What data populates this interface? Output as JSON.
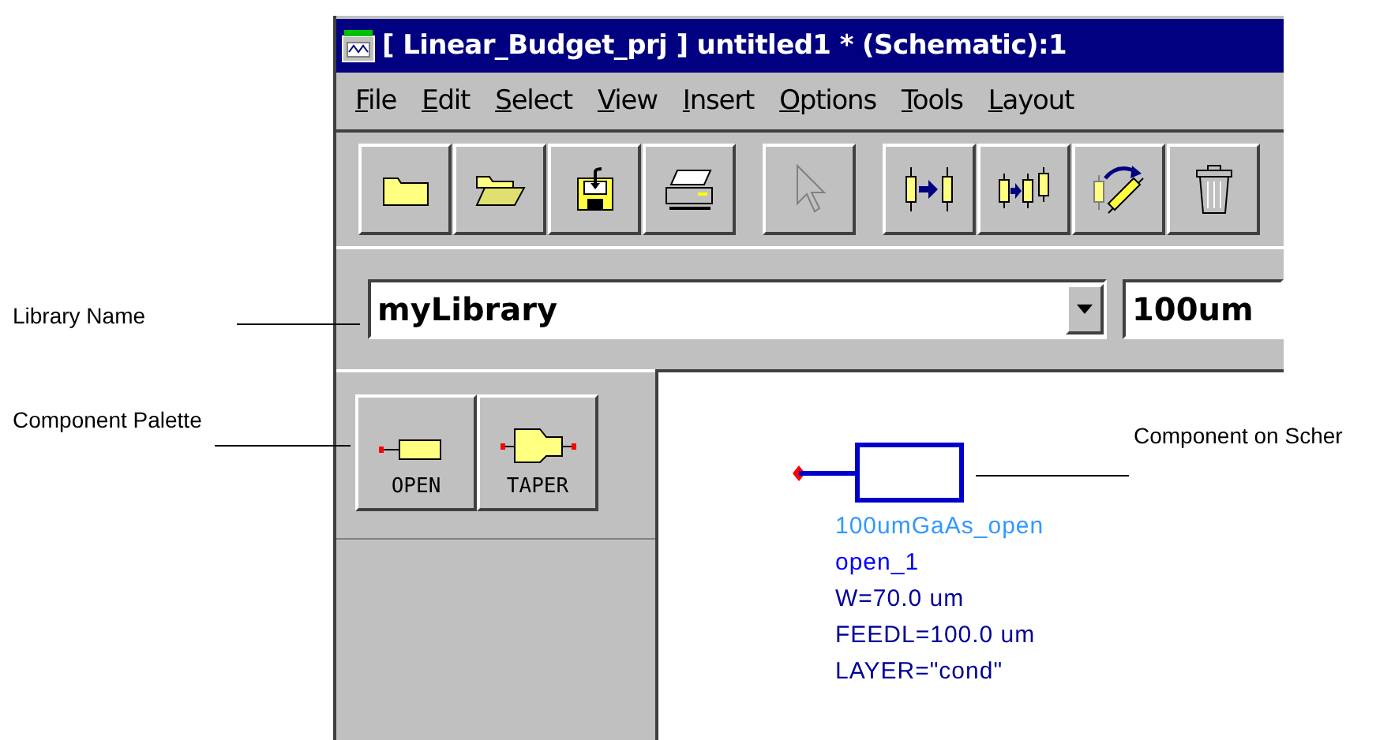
{
  "annotations": [
    {
      "text": "Library Name",
      "kind": "library"
    },
    {
      "text": "Component Palette",
      "kind": "palette"
    },
    {
      "text": "Component on Scher",
      "kind": "component"
    }
  ],
  "window": {
    "title": "[ Linear_Budget_prj ] untitled1  * (Schematic):1"
  },
  "menu": [
    "File",
    "Edit",
    "Select",
    "View",
    "Insert",
    "Options",
    "Tools",
    "Layout"
  ],
  "toolbar": [
    {
      "kind": "new"
    },
    {
      "kind": "open"
    },
    {
      "kind": "save"
    },
    {
      "kind": "print"
    },
    {
      "kind": "pointer",
      "disabled": true
    },
    {
      "kind": "insert"
    },
    {
      "kind": "copy"
    },
    {
      "kind": "rotate"
    },
    {
      "kind": "delete"
    }
  ],
  "library_field": {
    "value": "myLibrary"
  },
  "component_field": {
    "value": "100um"
  },
  "palette": [
    {
      "label": "OPEN",
      "kind": "open"
    },
    {
      "label": "TAPER",
      "kind": "taper"
    }
  ],
  "schematic": {
    "labels": [
      {
        "text": "100umGaAs_open",
        "color": "#3399ff"
      },
      {
        "text": "open_1",
        "color": "#0000ff"
      },
      {
        "text": "W=70.0 um",
        "color": "#000099"
      },
      {
        "text": "FEEDL=100.0 um",
        "color": "#000099"
      },
      {
        "text": "LAYER=\"cond\"",
        "color": "#000099"
      }
    ]
  }
}
